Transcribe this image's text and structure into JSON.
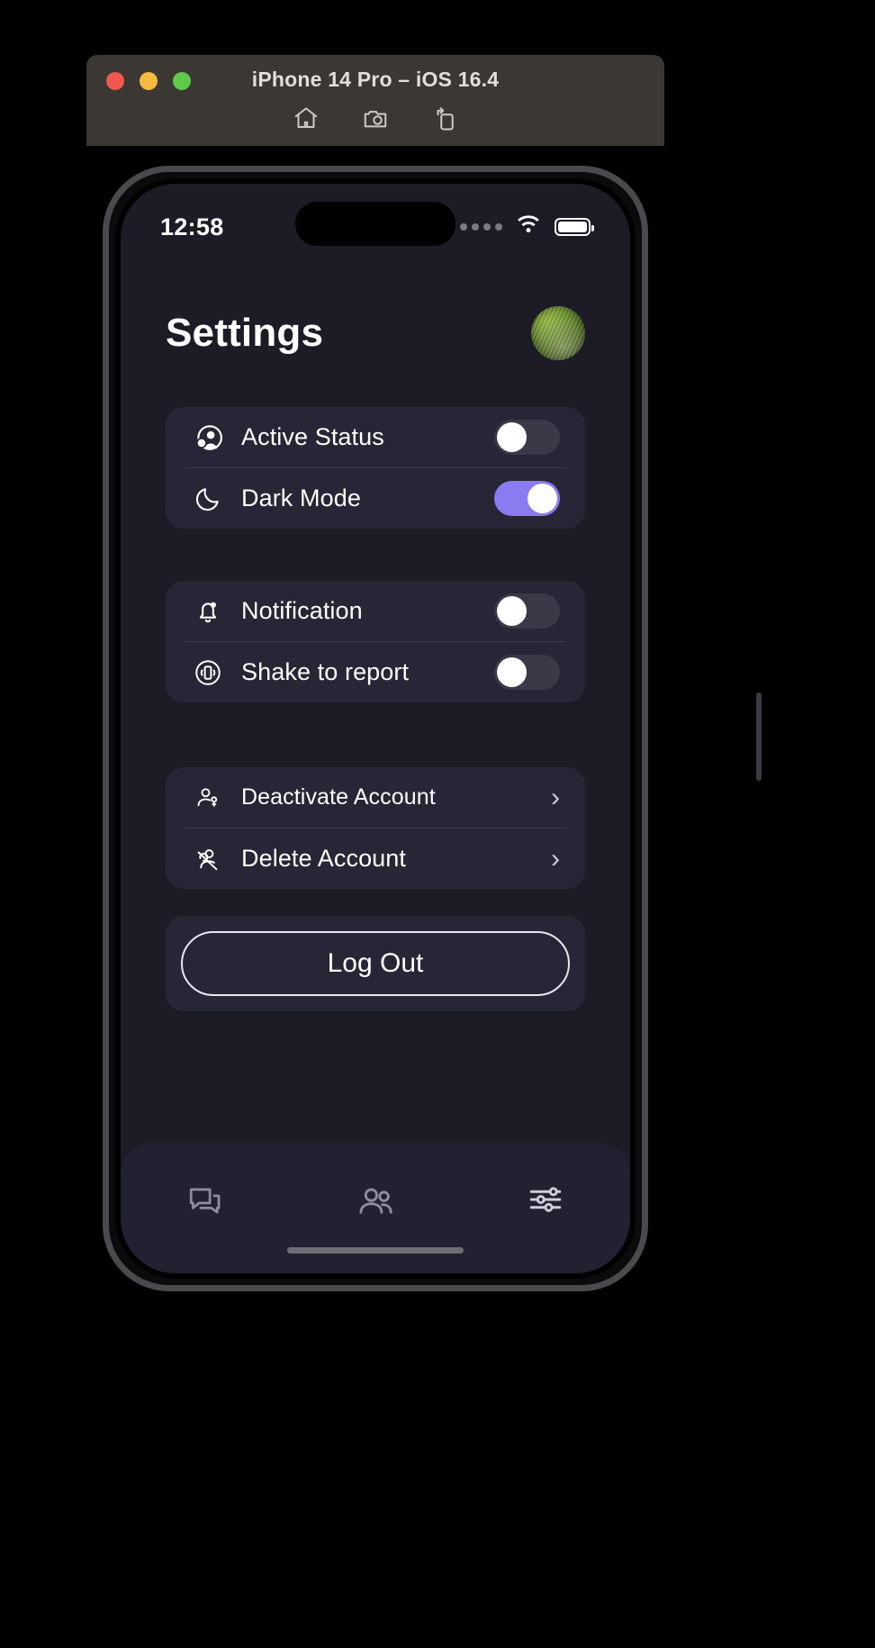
{
  "simulator": {
    "title": "iPhone 14 Pro – iOS 16.4",
    "toolbar": [
      {
        "name": "home-icon",
        "label": "Home"
      },
      {
        "name": "screenshot-icon",
        "label": "Screenshot"
      },
      {
        "name": "rotate-icon",
        "label": "Rotate"
      }
    ],
    "traffic_lights": [
      {
        "name": "close",
        "color": "#f2584d"
      },
      {
        "name": "minimize",
        "color": "#f5bb3e"
      },
      {
        "name": "zoom",
        "color": "#5fc94a"
      }
    ]
  },
  "status_bar": {
    "time": "12:58",
    "cellular_icon": "cellular-dots-icon",
    "wifi_icon": "wifi-icon",
    "battery_icon": "battery-full-icon"
  },
  "header": {
    "title": "Settings",
    "avatar_name": "profile-avatar"
  },
  "colors": {
    "background": "#1c1b26",
    "card": "#272636",
    "toggle_on": "#8b7bf0",
    "toggle_off": "#3a3948",
    "text": "#ffffff",
    "tabbar": "#222131"
  },
  "sections": [
    {
      "name": "preferences",
      "rows": [
        {
          "label": "Active Status",
          "icon": "active-status-icon",
          "control": "toggle",
          "on": false
        },
        {
          "label": "Dark Mode",
          "icon": "moon-icon",
          "control": "toggle",
          "on": true
        }
      ]
    },
    {
      "name": "alerts",
      "rows": [
        {
          "label": "Notification",
          "icon": "bell-icon",
          "control": "toggle",
          "on": false
        },
        {
          "label": "Shake to report",
          "icon": "shake-phone-icon",
          "control": "toggle",
          "on": false
        }
      ]
    },
    {
      "name": "account",
      "rows": [
        {
          "label": "Deactivate Account",
          "icon": "person-key-icon",
          "control": "chevron",
          "chevron": "›"
        },
        {
          "label": "Delete Account",
          "icon": "person-slash-icon",
          "control": "chevron",
          "chevron": "›"
        }
      ]
    }
  ],
  "logout": {
    "label": "Log Out"
  },
  "tab_bar": {
    "items": [
      {
        "name": "tab-chats",
        "icon": "chat-bubbles-icon",
        "active": false
      },
      {
        "name": "tab-people",
        "icon": "people-icon",
        "active": false
      },
      {
        "name": "tab-settings",
        "icon": "sliders-icon",
        "active": true
      }
    ]
  }
}
